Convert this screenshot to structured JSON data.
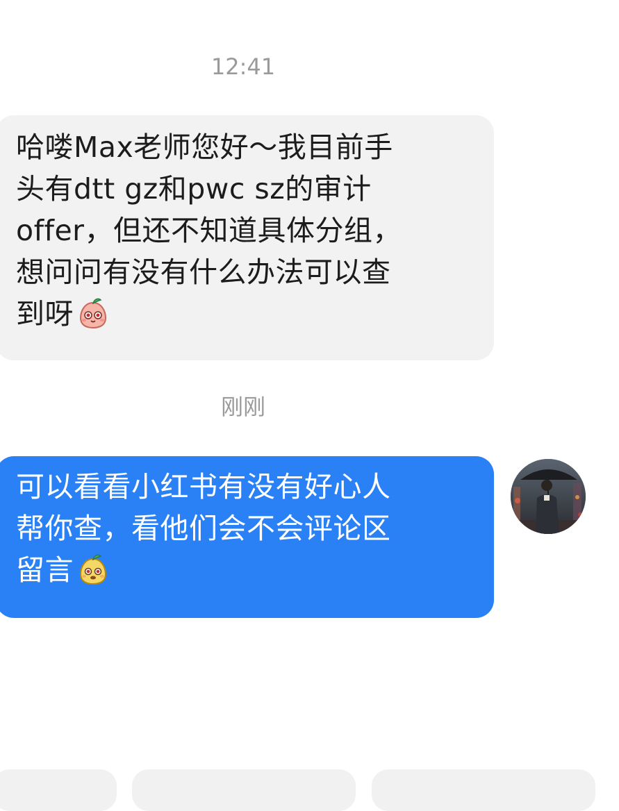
{
  "chat": {
    "timestamp_1": "12:41",
    "incoming_message": {
      "lines": [
        "哈喽Max老师您好～我目前手",
        "头有dtt gz和pwc sz的审计",
        "offer，但还不知道具体分组，",
        "想问问有没有什么办法可以查",
        "到呀"
      ],
      "sticker": "pink-peach-sticker"
    },
    "timestamp_2": "刚刚",
    "outgoing_message": {
      "lines": [
        "可以看看小红书有没有好心人",
        "帮你查，看他们会不会评论区",
        "留言"
      ],
      "sticker": "yellow-peach-sticker"
    },
    "avatar_icon": "man-with-umbrella-avatar"
  },
  "quick_replies": [
    "",
    "",
    ""
  ],
  "colors": {
    "incoming_bg": "#f2f2f2",
    "outgoing_bg": "#2a80f5",
    "timestamp": "#9a9a9a"
  }
}
